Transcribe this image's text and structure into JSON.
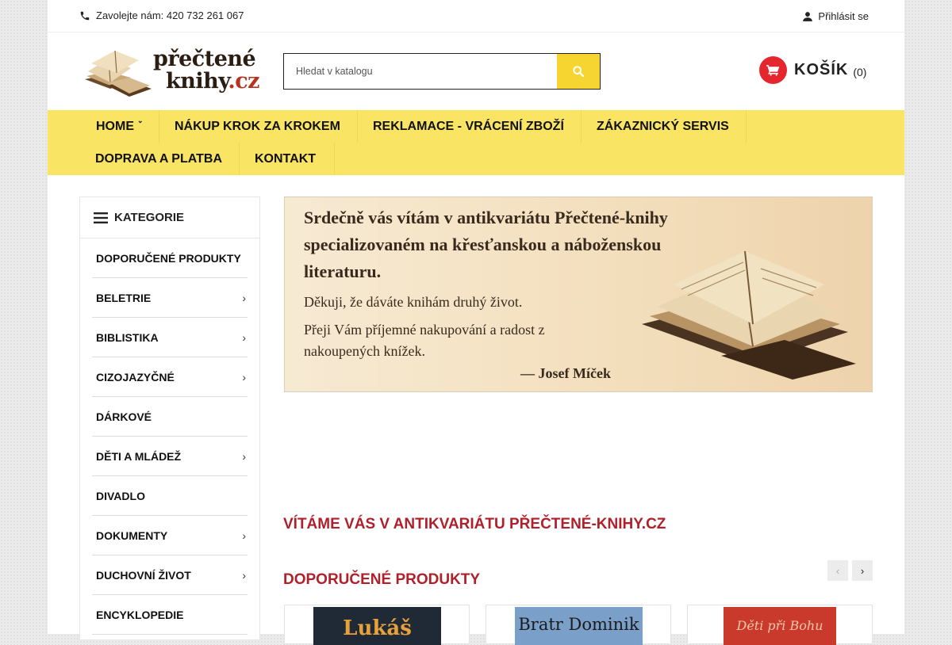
{
  "topbar": {
    "phone_label": "Zavolejte nám: 420 732 261 067",
    "login_label": "Přihlásit se"
  },
  "header": {
    "logo_word1": "přečtené",
    "logo_word2": "knihy",
    "logo_tld": ".cz",
    "search_placeholder": "Hledat v katalogu",
    "cart_label": "KOŠÍK",
    "cart_count": "(0)"
  },
  "nav": {
    "items": [
      "HOME",
      "NÁKUP KROK ZA KROKEM",
      "REKLAMACE - VRÁCENÍ ZBOŽÍ",
      "ZÁKAZNICKÝ SERVIS",
      "DOPRAVA A PLATBA",
      "KONTAKT"
    ]
  },
  "sidebar": {
    "title": "KATEGORIE",
    "items": [
      {
        "label": "DOPORUČENÉ PRODUKTY",
        "has_children": false
      },
      {
        "label": "BELETRIE",
        "has_children": true
      },
      {
        "label": "BIBLISTIKA",
        "has_children": true
      },
      {
        "label": "CIZOJAZYČNÉ",
        "has_children": true
      },
      {
        "label": "DÁRKOVÉ",
        "has_children": false
      },
      {
        "label": "DĚTI A MLÁDEŽ",
        "has_children": true
      },
      {
        "label": "DIVADLO",
        "has_children": false
      },
      {
        "label": "DOKUMENTY",
        "has_children": true
      },
      {
        "label": "DUCHOVNÍ ŽIVOT",
        "has_children": true
      },
      {
        "label": "ENCYKLOPEDIE",
        "has_children": false
      }
    ]
  },
  "banner": {
    "line1": "Srdečně vás vítám v antikvariátu Přečtené-knihy",
    "line2": "specializovaném na křesťanskou a náboženskou",
    "line3": "literaturu.",
    "line4": "Děkuji, že dáváte knihám druhý život.",
    "line5": "Přeji Vám příjemné nakupování a radost z",
    "line6": "nakoupených knížek.",
    "signature": "— Josef Míček"
  },
  "main": {
    "welcome_title": "VÍTÁME VÁS V ANTIKVARIÁTU PŘEČTENÉ-KNIHY.CZ",
    "recommended_title": "DOPORUČENÉ PRODUKTY",
    "prev_arrow": "‹",
    "next_arrow": "›",
    "products": [
      {
        "cover_text": "Lukáš",
        "cover_color": "#1f2a36",
        "text_color": "#e8a13a"
      },
      {
        "cover_text": "Bratr Dominik",
        "cover_color": "#7aa0c9",
        "text_color": "#1b1b1b"
      },
      {
        "cover_text": "Děti při Bohu",
        "cover_color": "#c93a2c",
        "text_color": "#f3c7a8"
      }
    ]
  },
  "colors": {
    "accent_yellow": "#f9e463",
    "search_button": "#f6d531",
    "cart_red": "#e5262e",
    "heading_red": "#b01f2a"
  }
}
